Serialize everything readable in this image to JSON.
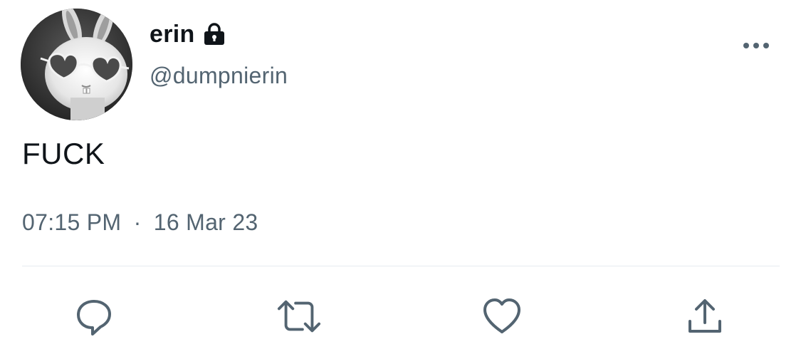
{
  "user": {
    "display_name": "erin",
    "handle": "@dumpnierin",
    "avatar": "bunny-with-heart-sunglasses",
    "protected_icon": "lock-icon"
  },
  "tweet": {
    "text": "FUCK",
    "time": "07:15 PM",
    "separator": "·",
    "date": "16 Mar 23"
  },
  "actions": {
    "more": "more-options-icon",
    "reply": "reply-icon",
    "retweet": "retweet-icon",
    "like": "like-icon",
    "share": "share-icon"
  },
  "colors": {
    "text_primary": "#0f1419",
    "text_secondary": "#536471",
    "icon": "#536471",
    "divider": "#e6ecf0"
  }
}
